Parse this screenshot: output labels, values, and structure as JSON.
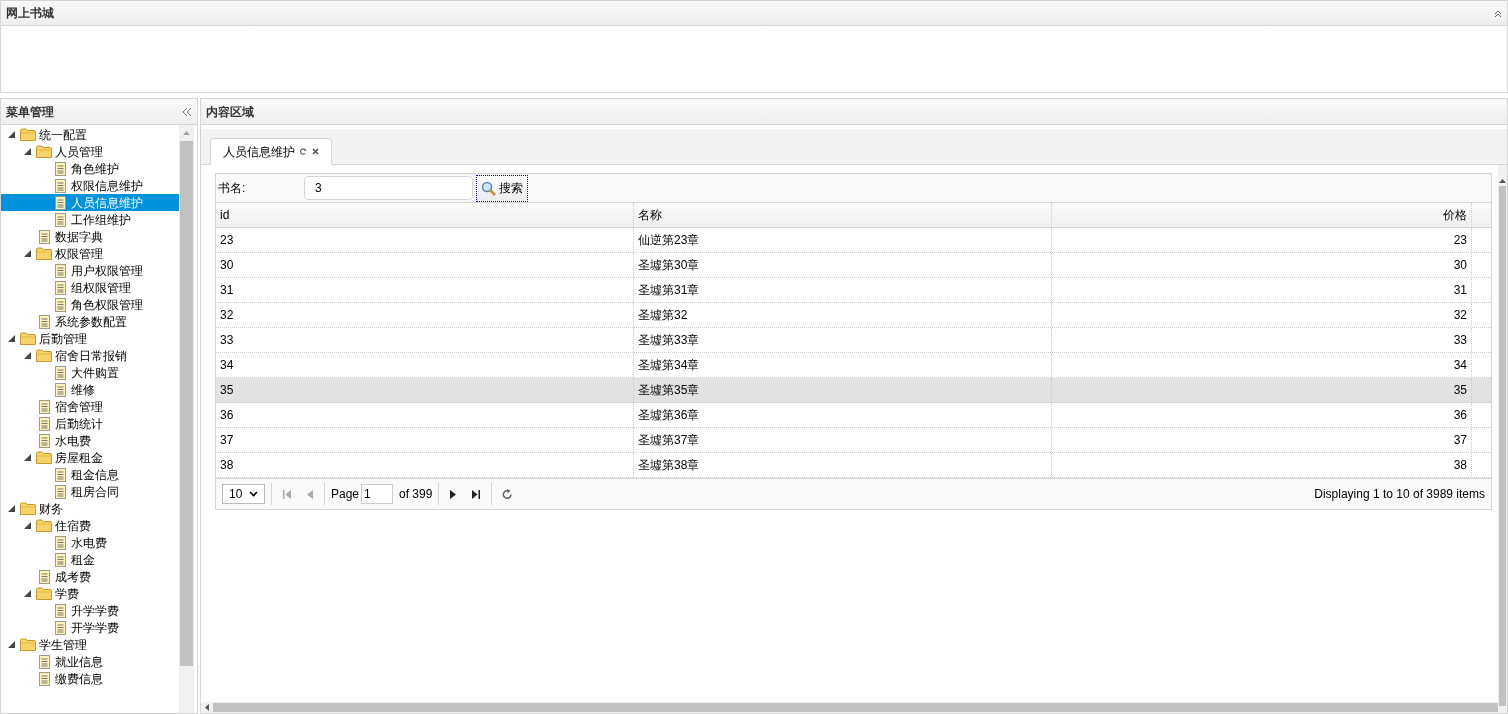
{
  "header_panel": {
    "title": "网上书城"
  },
  "menu_panel": {
    "title": "菜单管理",
    "tree": [
      {
        "label": "统一配置",
        "kind": "folder",
        "expanded": true,
        "selected": false,
        "children": [
          {
            "label": "人员管理",
            "kind": "folder",
            "expanded": true,
            "selected": false,
            "children": [
              {
                "label": "角色维护",
                "kind": "file",
                "selected": false
              },
              {
                "label": "权限信息维护",
                "kind": "file",
                "selected": false
              },
              {
                "label": "人员信息维护",
                "kind": "file",
                "selected": true
              },
              {
                "label": "工作组维护",
                "kind": "file",
                "selected": false
              }
            ]
          },
          {
            "label": "数据字典",
            "kind": "file",
            "selected": false
          },
          {
            "label": "权限管理",
            "kind": "folder",
            "expanded": true,
            "selected": false,
            "children": [
              {
                "label": "用户权限管理",
                "kind": "file",
                "selected": false
              },
              {
                "label": "组权限管理",
                "kind": "file",
                "selected": false
              },
              {
                "label": "角色权限管理",
                "kind": "file",
                "selected": false
              }
            ]
          },
          {
            "label": "系统参数配置",
            "kind": "file",
            "selected": false
          }
        ]
      },
      {
        "label": "后勤管理",
        "kind": "folder",
        "expanded": true,
        "selected": false,
        "children": [
          {
            "label": "宿舍日常报销",
            "kind": "folder",
            "expanded": true,
            "selected": false,
            "children": [
              {
                "label": "大件购置",
                "kind": "file",
                "selected": false
              },
              {
                "label": "维修",
                "kind": "file",
                "selected": false
              }
            ]
          },
          {
            "label": "宿舍管理",
            "kind": "file",
            "selected": false
          },
          {
            "label": "后勤统计",
            "kind": "file",
            "selected": false
          },
          {
            "label": "水电费",
            "kind": "file",
            "selected": false
          },
          {
            "label": "房屋租金",
            "kind": "folder",
            "expanded": true,
            "selected": false,
            "children": [
              {
                "label": "租金信息",
                "kind": "file",
                "selected": false
              },
              {
                "label": "租房合同",
                "kind": "file",
                "selected": false
              }
            ]
          }
        ]
      },
      {
        "label": "财务",
        "kind": "folder",
        "expanded": true,
        "selected": false,
        "children": [
          {
            "label": "住宿费",
            "kind": "folder",
            "expanded": true,
            "selected": false,
            "children": [
              {
                "label": "水电费",
                "kind": "file",
                "selected": false
              },
              {
                "label": "租金",
                "kind": "file",
                "selected": false
              }
            ]
          },
          {
            "label": "成考费",
            "kind": "file",
            "selected": false
          },
          {
            "label": "学费",
            "kind": "folder",
            "expanded": true,
            "selected": false,
            "children": [
              {
                "label": "升学学费",
                "kind": "file",
                "selected": false
              },
              {
                "label": "开学学费",
                "kind": "file",
                "selected": false
              }
            ]
          }
        ]
      },
      {
        "label": "学生管理",
        "kind": "folder",
        "expanded": true,
        "selected": false,
        "children": [
          {
            "label": "就业信息",
            "kind": "file",
            "selected": false
          },
          {
            "label": "缴费信息",
            "kind": "file",
            "selected": false
          }
        ]
      }
    ]
  },
  "content_panel": {
    "title": "内容区域",
    "tabs": [
      {
        "label": "人员信息维护",
        "selected": true
      }
    ],
    "search": {
      "label": "书名:",
      "value": "3",
      "button": "搜索"
    },
    "table": {
      "columns": [
        "id",
        "名称",
        "价格"
      ],
      "rows": [
        {
          "cells": [
            "23",
            "仙逆第23章",
            "23"
          ],
          "selected": false
        },
        {
          "cells": [
            "30",
            "圣墟第30章",
            "30"
          ],
          "selected": false
        },
        {
          "cells": [
            "31",
            "圣墟第31章",
            "31"
          ],
          "selected": false
        },
        {
          "cells": [
            "32",
            "圣墟第32",
            "32"
          ],
          "selected": false
        },
        {
          "cells": [
            "33",
            "圣墟第33章",
            "33"
          ],
          "selected": false
        },
        {
          "cells": [
            "34",
            "圣墟第34章",
            "34"
          ],
          "selected": false
        },
        {
          "cells": [
            "35",
            "圣墟第35章",
            "35"
          ],
          "selected": true
        },
        {
          "cells": [
            "36",
            "圣墟第36章",
            "36"
          ],
          "selected": false
        },
        {
          "cells": [
            "37",
            "圣墟第37章",
            "37"
          ],
          "selected": false
        },
        {
          "cells": [
            "38",
            "圣墟第38章",
            "38"
          ],
          "selected": false
        }
      ]
    },
    "pager": {
      "page_size": "10",
      "page_label": "Page",
      "page": "1",
      "of_label": "of 399",
      "summary": "Displaying 1 to 10 of 3989 items"
    }
  }
}
